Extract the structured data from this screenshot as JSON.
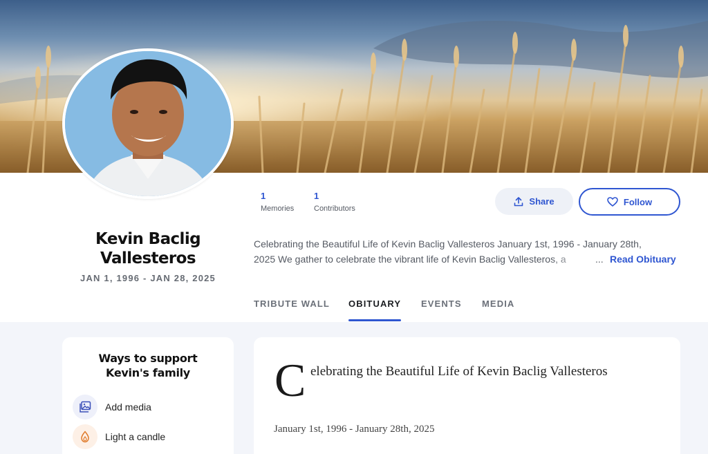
{
  "profile": {
    "name_line1": "Kevin Baclig",
    "name_line2": "Vallesteros",
    "dates": "JAN 1, 1996 - JAN 28, 2025",
    "avatar_icon": "portrait-photo",
    "cover_icon": "wheat-field-sunset-photo"
  },
  "stats": [
    {
      "value": "1",
      "label": "Memories"
    },
    {
      "value": "1",
      "label": "Contributors"
    }
  ],
  "actions": {
    "share_label": "Share",
    "follow_label": "Follow",
    "share_icon": "upload-icon",
    "follow_icon": "heart-icon"
  },
  "summary": {
    "line1": "Celebrating the Beautiful Life of Kevin Baclig Vallesteros January 1st, 1996 - January 28th,",
    "line2": "2025 We gather to celebrate the vibrant life of Kevin Baclig Vallesteros, a",
    "ellipsis": "...",
    "read_more": "Read Obituary"
  },
  "tabs": [
    {
      "label": "TRIBUTE WALL",
      "active": false
    },
    {
      "label": "OBITUARY",
      "active": true
    },
    {
      "label": "EVENTS",
      "active": false
    },
    {
      "label": "MEDIA",
      "active": false
    }
  ],
  "support": {
    "title_line1": "Ways to support",
    "title_line2": "Kevin's family",
    "items": [
      {
        "label": "Add media",
        "icon": "image-icon",
        "icon_color": "#3a4fb8",
        "bg": "#eef0fa"
      },
      {
        "label": "Light a candle",
        "icon": "flame-icon",
        "icon_color": "#e07b2c",
        "bg": "#fdf0e6"
      }
    ]
  },
  "obituary": {
    "drop_cap": "C",
    "title_rest": "elebrating the Beautiful Life of Kevin Baclig Vallesteros",
    "dates": "January 1st, 1996 - January 28th, 2025"
  },
  "colors": {
    "accent": "#2f56d1",
    "page_bg": "#f3f5fa",
    "muted_text": "#555a63"
  }
}
